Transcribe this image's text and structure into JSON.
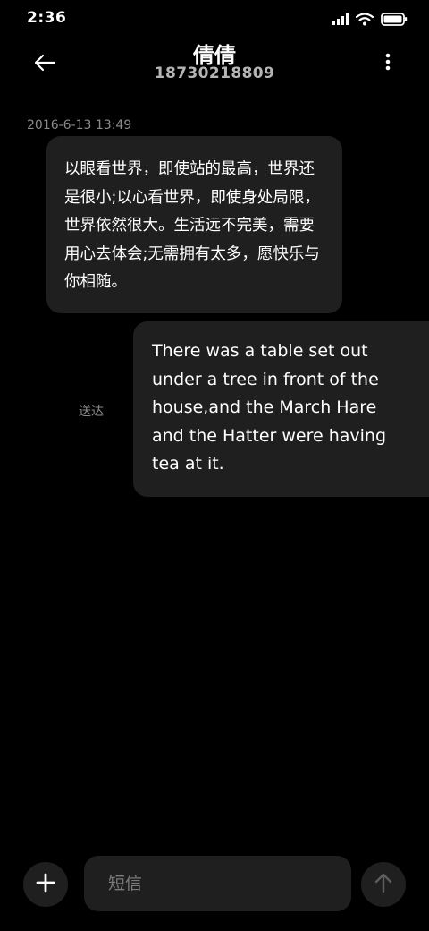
{
  "status_bar": {
    "time": "2:36"
  },
  "header": {
    "contact_name": "倩倩",
    "contact_number": "18730218809"
  },
  "conversation": {
    "timestamp": "2016-6-13 13:49",
    "received_message": "以眼看世界，即使站的最高，世界还是很小;以心看世界，即使身处局限，世界依然很大。生活远不完美，需要用心去体会;无需拥有太多，愿快乐与你相随。",
    "sent_message": "There was a table set out under a tree in front of the house,and the March Hare and the Hatter were having tea at it.",
    "delivery_status": "送达"
  },
  "composer": {
    "placeholder": "短信"
  },
  "colors": {
    "background": "#000000",
    "bubble": "#1f1f1f",
    "secondary_text": "#8c8c8c"
  }
}
